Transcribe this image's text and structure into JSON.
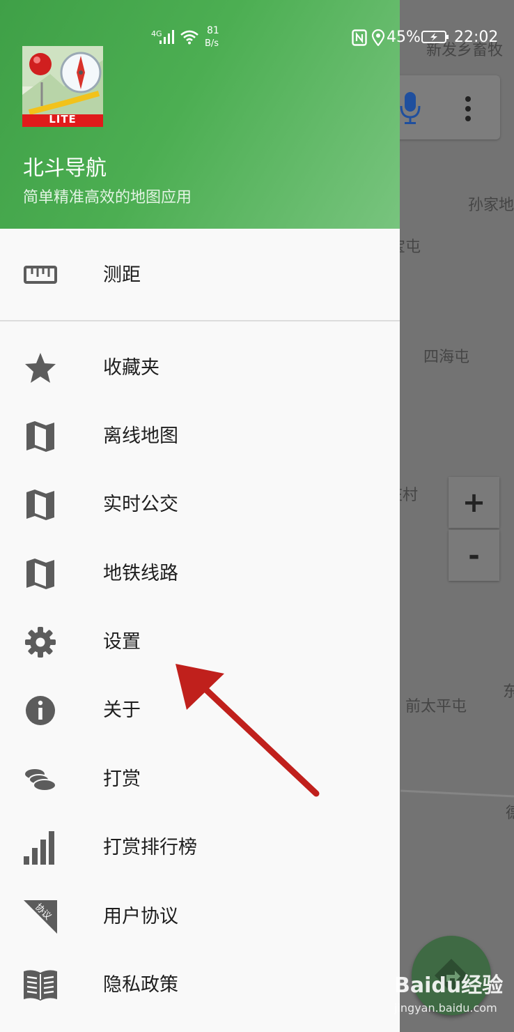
{
  "status_bar": {
    "network": "4G",
    "speed_value": "81",
    "speed_unit": "B/s",
    "battery": "45%",
    "time": "22:02"
  },
  "drawer": {
    "app_name": "北斗导航",
    "app_slogan": "简单精准高效的地图应用",
    "logo_badge": "LITE",
    "menu": [
      {
        "label": "测距",
        "icon": "ruler-icon"
      },
      {
        "label": "收藏夹",
        "icon": "star-icon"
      },
      {
        "label": "离线地图",
        "icon": "map-icon"
      },
      {
        "label": "实时公交",
        "icon": "map-icon"
      },
      {
        "label": "地铁线路",
        "icon": "map-icon"
      },
      {
        "label": "设置",
        "icon": "gear-icon"
      },
      {
        "label": "关于",
        "icon": "info-icon"
      },
      {
        "label": "打赏",
        "icon": "coins-icon"
      },
      {
        "label": "打赏排行榜",
        "icon": "bar-chart-icon"
      },
      {
        "label": "用户协议",
        "icon": "agreement-icon",
        "icon_text": "协议"
      },
      {
        "label": "隐私政策",
        "icon": "book-icon"
      }
    ]
  },
  "map": {
    "labels": [
      "新发乡畜牧",
      "孙家地",
      "宝屯",
      "四海屯",
      "庄村",
      "前太平屯",
      "东",
      "德"
    ],
    "zoom_in": "+",
    "zoom_out": "-"
  },
  "watermark": {
    "brand": "Baidu经验",
    "url": "jingyan.baidu.com"
  },
  "colors": {
    "header_green": "#4cae52",
    "annotation_arrow": "#c0201c"
  }
}
